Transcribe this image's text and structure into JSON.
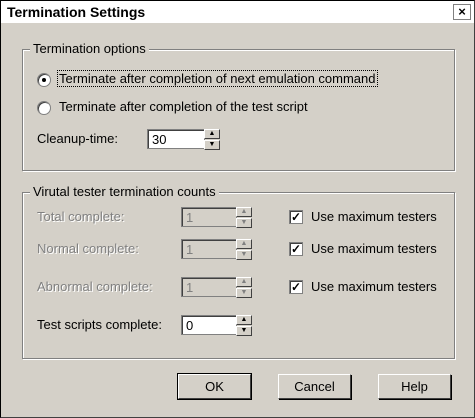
{
  "window": {
    "title": "Termination Settings",
    "close_glyph": "×"
  },
  "termination_options": {
    "legend": "Termination options",
    "radio_next_command": "Terminate after completion of next emulation command",
    "radio_test_script": "Terminate after completion of the test script",
    "selected": "next_command",
    "cleanup_label": "Cleanup-time:",
    "cleanup_value": "30"
  },
  "counts": {
    "legend": "Virutal tester termination counts",
    "rows": [
      {
        "label": "Total complete:",
        "value": "1",
        "checkbox_label": "Use maximum testers",
        "checked": true,
        "enabled": false
      },
      {
        "label": "Normal complete:",
        "value": "1",
        "checkbox_label": "Use maximum testers",
        "checked": true,
        "enabled": false
      },
      {
        "label": "Abnormal complete:",
        "value": "1",
        "checkbox_label": "Use maximum testers",
        "checked": true,
        "enabled": false
      },
      {
        "label": "Test scripts complete:",
        "value": "0",
        "enabled": true
      }
    ]
  },
  "buttons": {
    "ok": "OK",
    "cancel": "Cancel",
    "help": "Help"
  },
  "icons": {
    "up": "up-arrow-icon",
    "down": "down-arrow-icon",
    "check": "check-icon",
    "close": "close-icon"
  }
}
